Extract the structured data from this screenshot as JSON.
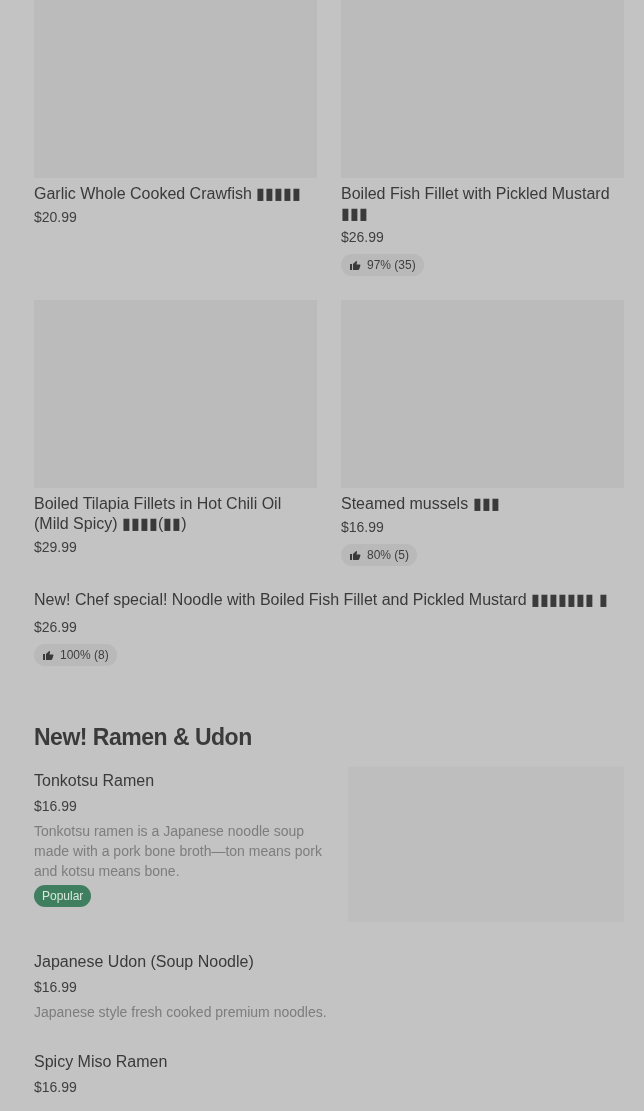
{
  "grid_items": [
    {
      "name": "Garlic Whole Cooked Crawfish ▮▮▮▮▮",
      "price": "$20.99"
    },
    {
      "name": "Boiled Fish Fillet with Pickled Mustard ▮▮▮",
      "price": "$26.99",
      "rating": "97% (35)"
    },
    {
      "name": "Boiled Tilapia Fillets in Hot Chili Oil (Mild Spicy) ▮▮▮▮(▮▮)",
      "price": "$29.99"
    },
    {
      "name": "Steamed mussels ▮▮▮",
      "price": "$16.99",
      "rating": "80% (5)"
    }
  ],
  "wide_item": {
    "name": "New! Chef special! Noodle with Boiled Fish Fillet and Pickled Mustard ▮▮▮▮▮▮▮ ▮",
    "price": "$26.99",
    "rating": "100% (8)"
  },
  "section": {
    "title": "New! Ramen & Udon",
    "items": [
      {
        "name": "Tonkotsu Ramen",
        "price": "$16.99",
        "description": "Tonkotsu ramen is a Japanese noodle soup made with a pork bone broth—ton means pork and kotsu means bone.",
        "badge": "Popular",
        "has_image": true
      },
      {
        "name": "Japanese Udon (Soup Noodle)",
        "price": "$16.99",
        "description": "Japanese style fresh cooked premium noodles.",
        "has_image": false
      },
      {
        "name": "Spicy Miso Ramen",
        "price": "$16.99",
        "has_image": false
      }
    ]
  }
}
